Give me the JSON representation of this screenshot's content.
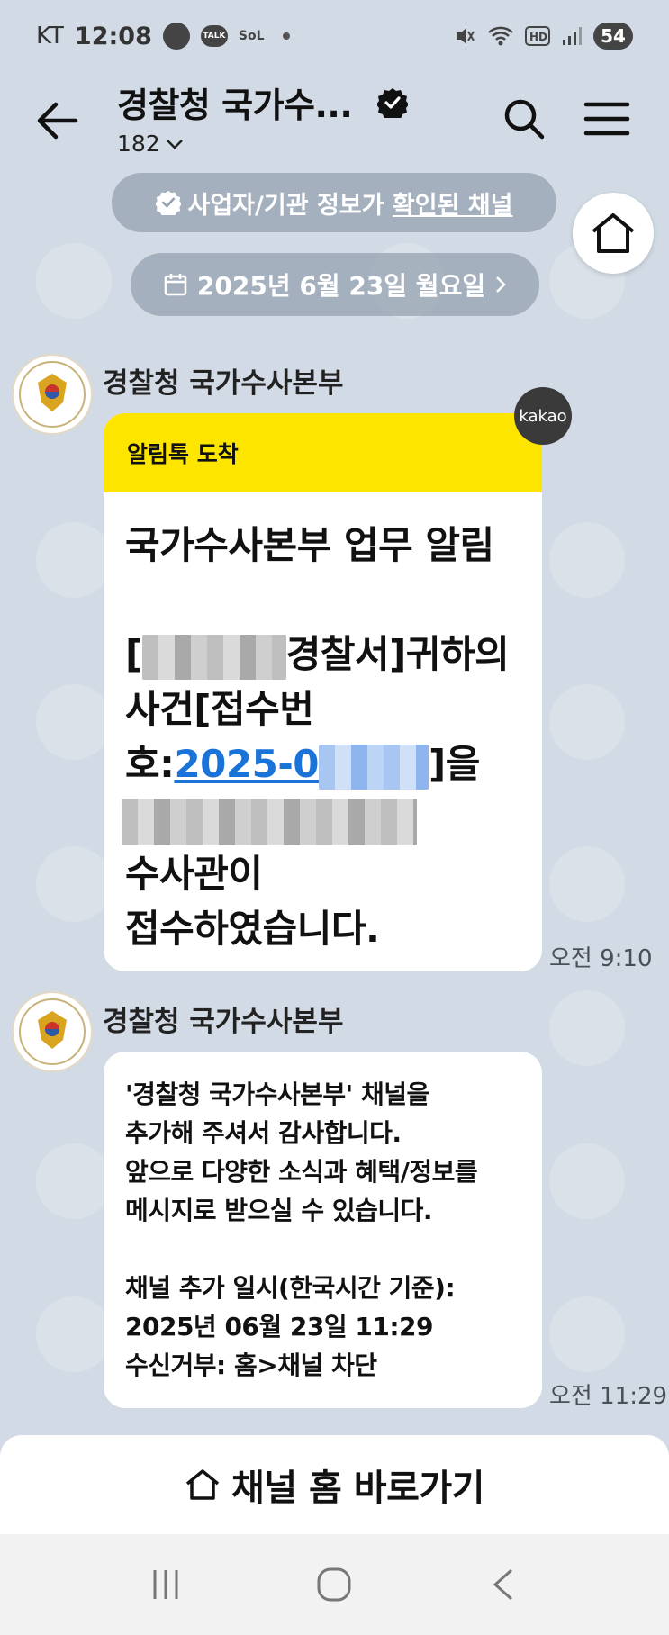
{
  "status": {
    "carrier": "KT",
    "time": "12:08",
    "talk_label": "TALK",
    "sol_label": "SoL",
    "battery": "54"
  },
  "header": {
    "title": "경찰청 국가수...",
    "member_count": "182"
  },
  "banners": {
    "verified_prefix": "사업자/기관 정보가 ",
    "verified_link": "확인된 채널",
    "date": "2025년 6월 23일 월요일"
  },
  "messages": [
    {
      "sender": "경찰청 국가수사본부",
      "badge": "kakao",
      "head": "알림톡 도착",
      "title": "국가수사본부 업무 알림",
      "line1_suffix": "경찰서]귀하의",
      "line1_prefix": "[",
      "line2": "사건[접수번",
      "line3_prefix": "호:",
      "line3_link": "2025-0",
      "line3_suffix": "]을",
      "line5": "수사관이",
      "line6": "접수하였습니다.",
      "time": "오전 9:10"
    },
    {
      "sender": "경찰청 국가수사본부",
      "lines": [
        "'경찰청 국가수사본부' 채널을",
        "추가해 주셔서 감사합니다.",
        "앞으로 다양한 소식과 혜택/정보를",
        "메시지로 받으실 수 있습니다.",
        "",
        "채널 추가 일시(한국시간 기준):",
        "2025년 06월 23일 11:29",
        "수신거부: 홈>채널 차단"
      ],
      "time": "오전 11:29"
    }
  ],
  "bottom_button": {
    "label": "채널 홈 바로가기"
  },
  "colors": {
    "background": "#d2dbe5",
    "kakao_yellow": "#fee500",
    "link_blue": "#1a73d9"
  }
}
